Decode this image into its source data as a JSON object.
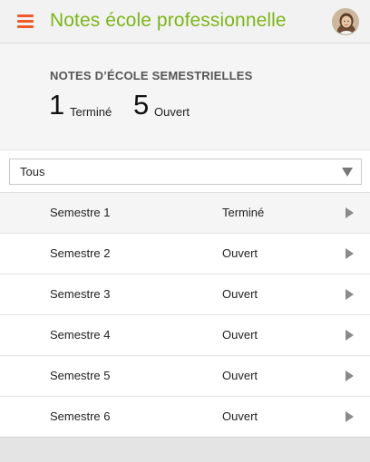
{
  "header": {
    "title": "Notes école professionnelle",
    "menu_icon": "hamburger-menu-icon",
    "accent_color": "#f05a24",
    "title_color": "#7cb518"
  },
  "summary": {
    "title": "NOTES D’ÉCOLE SEMESTRIELLES",
    "completed_count": "1",
    "completed_label": "Terminé",
    "open_count": "5",
    "open_label": "Ouvert"
  },
  "filter": {
    "selected": "Tous",
    "icon": "dropdown-arrow-icon"
  },
  "semesters": [
    {
      "name": "Semestre 1",
      "status": "Terminé"
    },
    {
      "name": "Semestre 2",
      "status": "Ouvert"
    },
    {
      "name": "Semestre 3",
      "status": "Ouvert"
    },
    {
      "name": "Semestre 4",
      "status": "Ouvert"
    },
    {
      "name": "Semestre 5",
      "status": "Ouvert"
    },
    {
      "name": "Semestre 6",
      "status": "Ouvert"
    }
  ]
}
